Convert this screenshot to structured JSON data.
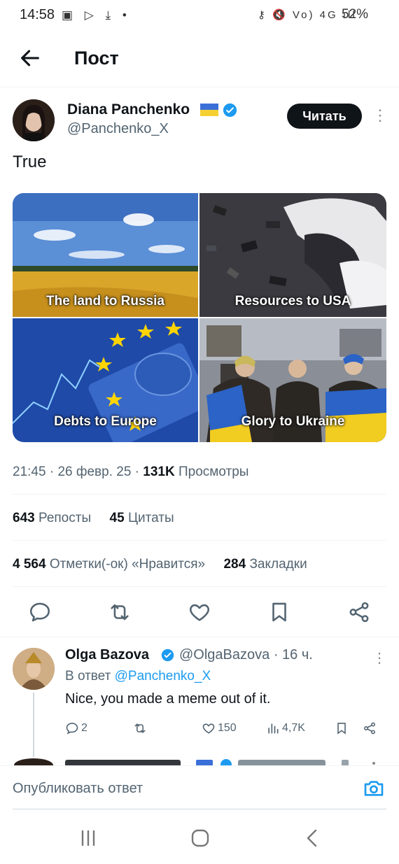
{
  "status_bar": {
    "time": "14:58",
    "left_icons": "▣ ▷ ⤓ •",
    "right_icons": "⚷ 🔇 Vo) 4G ıll",
    "battery": "52%"
  },
  "header": {
    "title": "Пост"
  },
  "tweet": {
    "author_name": "Diana Panchenko",
    "author_handle": "@Panchenko_X",
    "follow_label": "Читать",
    "text": "True",
    "media": [
      {
        "caption": "The land to Russia"
      },
      {
        "caption": "Resources to USA"
      },
      {
        "caption": "Debts to Europe"
      },
      {
        "caption": "Glory to Ukraine"
      }
    ],
    "time": "21:45",
    "date": "26 февр. 25",
    "views_count": "131K",
    "views_label": "Просмотры",
    "reposts_count": "643",
    "reposts_label": "Репосты",
    "quotes_count": "45",
    "quotes_label": "Цитаты",
    "likes_count": "4 564",
    "likes_label": "Отметки(-ок) «Нравится»",
    "bookmarks_count": "284",
    "bookmarks_label": "Закладки"
  },
  "reply": {
    "author_name": "Olga Bazova",
    "author_handle": "@OlgaBazova",
    "time": "16 ч.",
    "reply_prefix": "В ответ",
    "reply_to": "@Panchenko_X",
    "text": "Nice, you made a meme out of it.",
    "replies": "2",
    "likes": "150",
    "views": "4,7K"
  },
  "compose": {
    "placeholder": "Опубликовать ответ"
  },
  "colors": {
    "accent": "#1d9bf0",
    "text": "#0f1419",
    "muted": "#536471"
  },
  "icons": [
    "back-arrow-icon",
    "verified-icon",
    "ukraine-flag-icon",
    "more-icon",
    "reply-icon",
    "repost-icon",
    "like-icon",
    "bookmark-icon",
    "share-icon",
    "views-icon",
    "camera-icon",
    "recents-icon",
    "home-icon",
    "back-nav-icon"
  ]
}
